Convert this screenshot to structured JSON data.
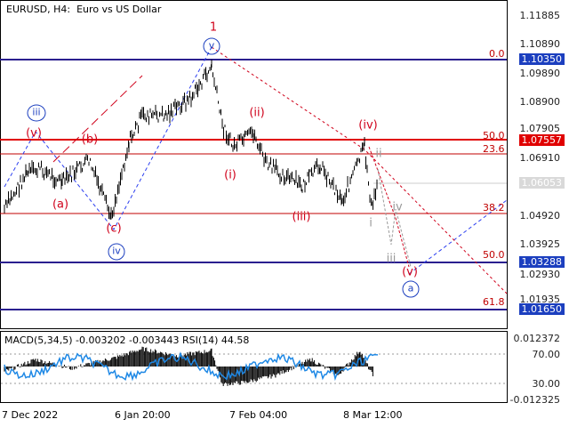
{
  "header": {
    "title": "EURUSD, H4:  Euro vs US Dollar"
  },
  "indicator": {
    "title": "MACD(5,34,5) -0.003202 -0.003443 RSI(14) 44.58",
    "scale": [
      "0.012372",
      "70.00",
      "30.00",
      "-0.012325"
    ]
  },
  "price_axis": {
    "labels": [
      "1.11885",
      "1.10890",
      "1.09890",
      "1.08900",
      "1.07905",
      "1.06910",
      "1.04920",
      "1.03925",
      "1.02930",
      "1.01935"
    ],
    "boxed": [
      "1.10350",
      "1.07557",
      "1.03288",
      "1.01650"
    ],
    "current": "1.06053"
  },
  "time_axis": [
    "7 Dec 2022",
    "6 Jan 20:00",
    "7 Feb 04:00",
    "8 Mar 12:00"
  ],
  "fib_levels": [
    "0.0",
    "50.0",
    "23.6",
    "38.2",
    "50.0",
    "61.8"
  ],
  "waves": {
    "wave_1": "1",
    "v_circle": "v",
    "iii_circle": "iii",
    "iv_circle": "iv",
    "a_circle": "a",
    "red_v_top": "(v)",
    "red_a": "(a)",
    "red_b": "(b)",
    "red_c": "(c)",
    "red_ii": "(ii)",
    "red_i": "(i)",
    "red_iii": "(iii)",
    "red_iv": "(iv)",
    "red_v_proj": "(v)",
    "gray_ii": "ii",
    "gray_i": "i",
    "gray_iv": "iv",
    "gray_iii": "iii"
  },
  "colors": {
    "level_line": "#2a1f8f",
    "red_line": "#e00000",
    "blue_dash": "#2b3ef0",
    "red_dash": "#d0021b",
    "candles": "#000000",
    "rsi": "#1e88e5"
  }
}
